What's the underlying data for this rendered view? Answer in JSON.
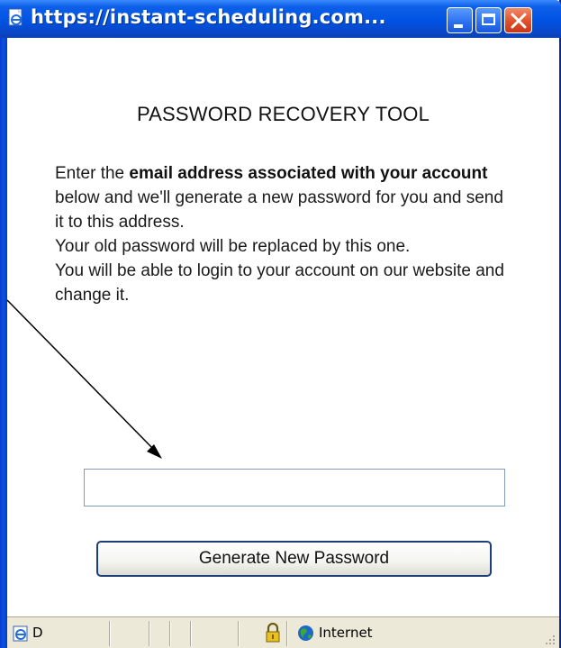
{
  "window": {
    "title": "https://instant-scheduling.com...",
    "title_icon": "ie-page-icon",
    "controls": {
      "minimize": "minimize-icon",
      "maximize": "maximize-icon",
      "close": "close-icon"
    }
  },
  "page": {
    "heading": "PASSWORD RECOVERY TOOL",
    "instructions": {
      "part1": "Enter the ",
      "bold": "email address associated with your account",
      "part2": " below and we'll generate a new password for you and send it to this address.",
      "line2": "Your old password will be replaced by this one.",
      "line3": "You will be able to login to your account on our website and change it."
    },
    "email_input": {
      "value": "",
      "placeholder": ""
    },
    "generate_button": "Generate New Password"
  },
  "statusbar": {
    "status_text": "D",
    "zone_label": "Internet",
    "icons": [
      "ie-icon",
      "lock-icon",
      "globe-icon",
      "resize-grip-icon"
    ]
  },
  "colors": {
    "titlebar": "#0054e3",
    "close_button": "#e0502a",
    "statusbar": "#ece9d8",
    "input_border": "#7f9db9",
    "button_border": "#1c3f7a"
  }
}
